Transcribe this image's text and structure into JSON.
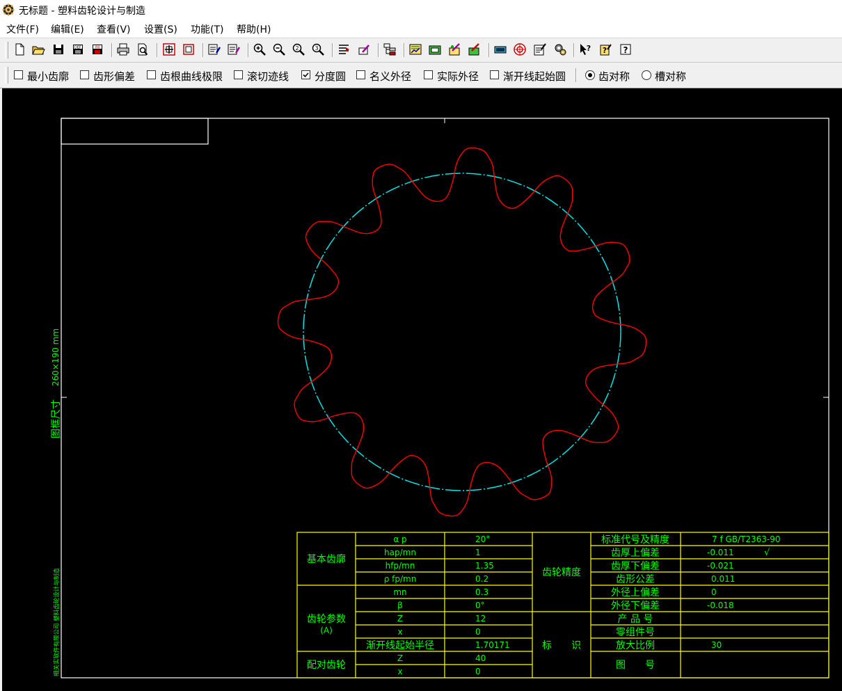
{
  "window": {
    "title": "无标题 - 塑料齿轮设计与制造"
  },
  "menu": [
    "文件(F)",
    "编辑(E)",
    "查看(V)",
    "设置(S)",
    "功能(T)",
    "帮助(H)"
  ],
  "toolbar_icons": [
    "new-file",
    "open-folder",
    "save-disk",
    "save-def",
    "save-ini",
    "print",
    "print-preview",
    "frame-fit",
    "frame-rect",
    "edit-gear",
    "edit-gear-2",
    "zoom-in",
    "zoom-out",
    "zoom-2",
    "zoom-3",
    "text-align",
    "pen-edit",
    "tree-view",
    "chart-1",
    "chart-2",
    "chart-3",
    "chart-4",
    "calculator",
    "gear-circle",
    "notes",
    "gears",
    "help-pointer",
    "help-notes",
    "help-question"
  ],
  "options": [
    {
      "label": "最小齿廓",
      "type": "checkbox",
      "checked": false
    },
    {
      "label": "齿形偏差",
      "type": "checkbox",
      "checked": false
    },
    {
      "label": "齿根曲线极限",
      "type": "checkbox",
      "checked": false
    },
    {
      "label": "滚切迹线",
      "type": "checkbox",
      "checked": false
    },
    {
      "label": "分度圆",
      "type": "checkbox",
      "checked": true
    },
    {
      "label": "名义外径",
      "type": "checkbox",
      "checked": false
    },
    {
      "label": "实际外径",
      "type": "checkbox",
      "checked": false
    },
    {
      "label": "渐开线起始圆",
      "type": "checkbox",
      "checked": false
    },
    {
      "label": "齿对称",
      "type": "radio",
      "checked": true
    },
    {
      "label": "槽对称",
      "type": "radio",
      "checked": false
    }
  ],
  "drawing": {
    "frame_size_label": "图框尺寸",
    "frame_size_value": "260×190 mm",
    "company": "相关实软件有限公司  塑料齿轮设计与制造",
    "gear": {
      "teeth": 12,
      "tooth_color": "#ff0000",
      "pitch_circle_color": "#00e5e5"
    },
    "colors": {
      "text": "#00ff00",
      "table_lines": "#ffff00",
      "frame": "#ffffff"
    }
  },
  "table": {
    "group_basic": "基本齿廓",
    "group_gear_params": "齿轮参数",
    "group_gear_params_sub": "(A)",
    "group_mating": "配对齿轮",
    "basic_rows": [
      {
        "symbol": "α p",
        "value": "20°"
      },
      {
        "symbol": "hap/mn",
        "value": "1"
      },
      {
        "symbol": "hfp/mn",
        "value": "1.35"
      },
      {
        "symbol": "ρ fp/mn",
        "value": "0.2"
      }
    ],
    "param_rows": [
      {
        "symbol": "mn",
        "value": "0.3"
      },
      {
        "symbol": "β",
        "value": "0°"
      },
      {
        "symbol": "Z",
        "value": "12"
      },
      {
        "symbol": "x",
        "value": "0"
      },
      {
        "symbol": "渐开线起始半径",
        "value": "1.70171"
      }
    ],
    "mating_rows": [
      {
        "symbol": "Z",
        "value": "40"
      },
      {
        "symbol": "x",
        "value": "0"
      }
    ],
    "precision_label": "齿轮精度",
    "precision_rows": [
      {
        "label": "标准代号及精度",
        "value": "7 f GB/T2363-90"
      },
      {
        "label": "齿厚上偏差",
        "value": "-0.011",
        "mark": "√"
      },
      {
        "label": "齿厚下偏差",
        "value": "-0.021"
      },
      {
        "label": "齿形公差",
        "value": "0.011"
      },
      {
        "label": "外径上偏差",
        "value": "0"
      },
      {
        "label": "外径下偏差",
        "value": "-0.018"
      }
    ],
    "id_label": "标　　识",
    "id_rows": [
      {
        "label": "产 品 号",
        "value": ""
      },
      {
        "label": "零组件号",
        "value": ""
      },
      {
        "label": "放大比例",
        "value": "30"
      }
    ],
    "drawing_no_label": "图　　号",
    "drawing_no_value": ""
  }
}
